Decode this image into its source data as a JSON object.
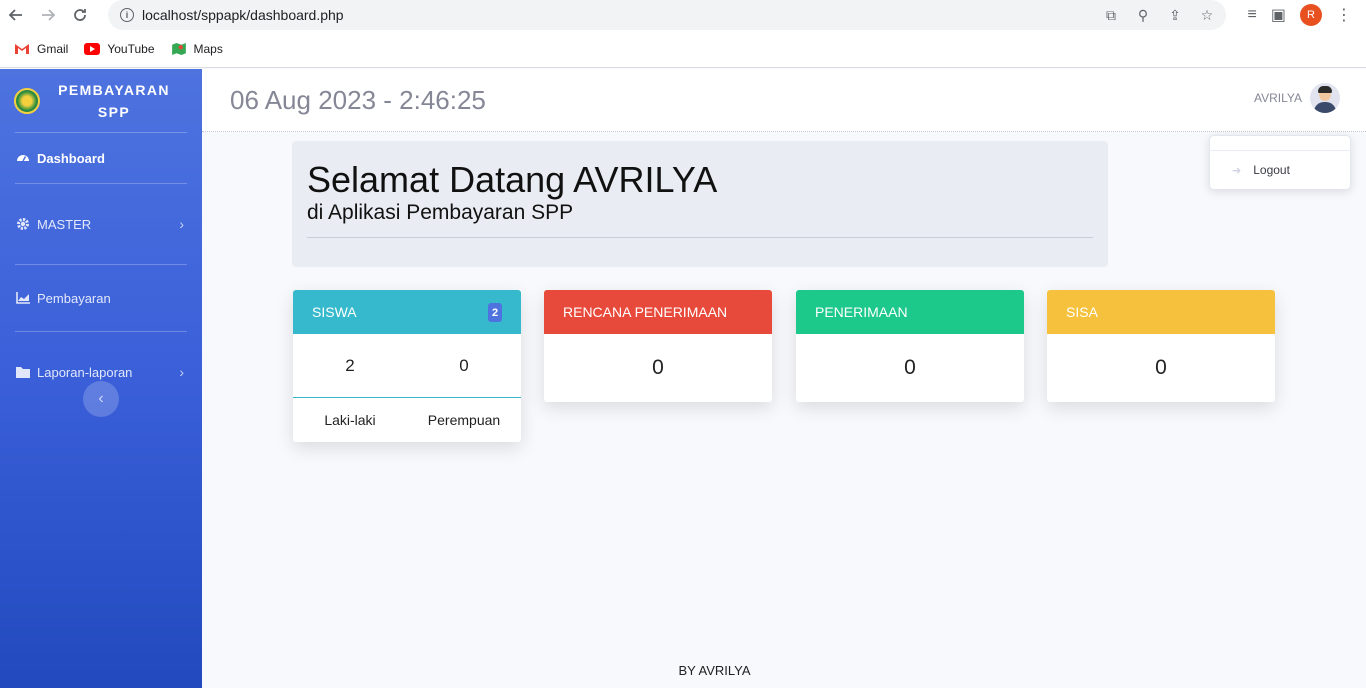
{
  "browser": {
    "url": "localhost/sppapk/dashboard.php",
    "profile_initial": "R",
    "bookmarks": [
      {
        "label": "Gmail",
        "icon": "gmail-icon"
      },
      {
        "label": "YouTube",
        "icon": "youtube-icon"
      },
      {
        "label": "Maps",
        "icon": "maps-icon"
      }
    ]
  },
  "sidebar": {
    "brand": "PEMBAYARAN SPP",
    "items": [
      {
        "label": "Dashboard",
        "icon": "dashboard-icon"
      },
      {
        "label": "MASTER",
        "icon": "gear-icon"
      },
      {
        "label": "Pembayaran",
        "icon": "chart-icon"
      },
      {
        "label": "Laporan-laporan",
        "icon": "folder-icon"
      }
    ]
  },
  "topbar": {
    "datetime": "06 Aug 2023 - 2:46:25",
    "username": "AVRILYA"
  },
  "dropdown": {
    "logout_label": "Logout"
  },
  "welcome": {
    "title": "Selamat Datang AVRILYA",
    "subtitle": "di Aplikasi Pembayaran SPP"
  },
  "cards": {
    "siswa": {
      "title": "SISWA",
      "badge": "2",
      "male_count": "2",
      "female_count": "0",
      "male_label": "Laki-laki",
      "female_label": "Perempuan",
      "color": "#36b9cc"
    },
    "rencana": {
      "title": "RENCANA PENERIMAAN",
      "value": "0",
      "color": "#e74a3b"
    },
    "penerimaan": {
      "title": "PENERIMAAN",
      "value": "0",
      "color": "#1cc88a"
    },
    "sisa": {
      "title": "SISA",
      "value": "0",
      "color": "#f6c23e"
    }
  },
  "footer": "BY AVRILYA"
}
